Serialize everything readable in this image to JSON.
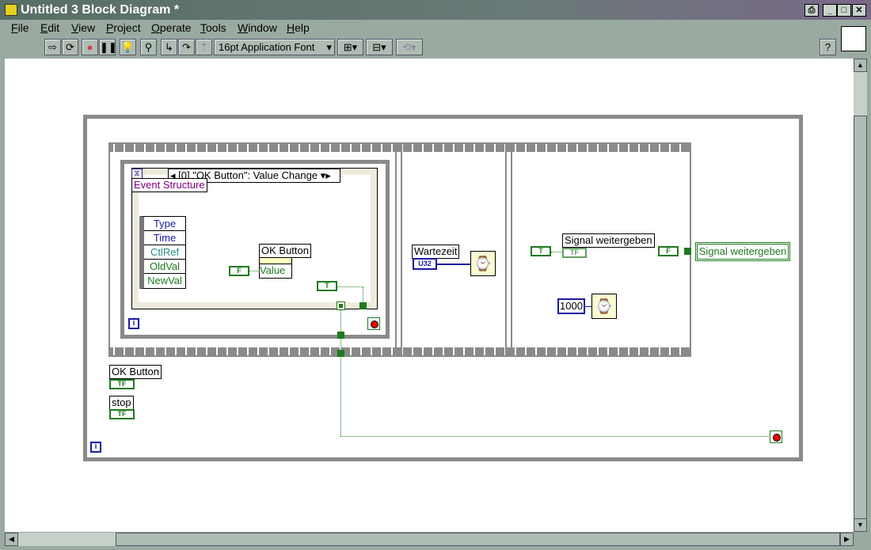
{
  "window": {
    "title": "Untitled 3 Block Diagram *"
  },
  "menu": [
    "File",
    "Edit",
    "View",
    "Project",
    "Operate",
    "Tools",
    "Window",
    "Help"
  ],
  "toolbar": {
    "font": "16pt Application Font"
  },
  "diagram": {
    "event_selector": "[0] \"OK Button\": Value Change",
    "event_structure_label": "Event Structure",
    "event_data": [
      "Type",
      "Time",
      "CtlRef",
      "OldVal",
      "NewVal"
    ],
    "property_node_label": "OK Button",
    "property_node_value": "Value",
    "wait_label": "Wartezeit",
    "wait_type": "U32",
    "signal_local_label": "Signal weitergeben",
    "signal_indicator": "Signal weitergeben",
    "constant_1000": "1000",
    "ok_button_terminal": "OK Button",
    "stop_terminal": "stop",
    "iter": "i",
    "tf": "TF"
  }
}
